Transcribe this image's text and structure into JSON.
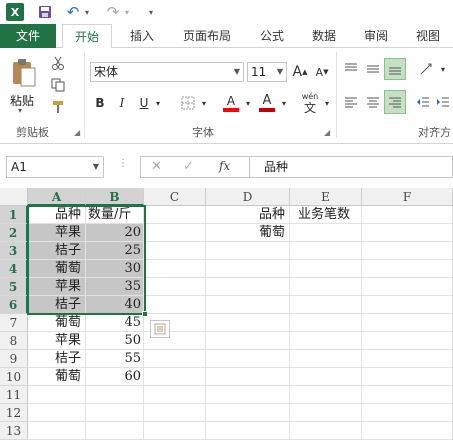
{
  "quick_access": {
    "logo": "X",
    "save_icon": "💾",
    "undo_icon": "↶",
    "undo_arrow": "▾",
    "redo_icon": "↷",
    "redo_arrow": "▾",
    "customize_icon": "▾"
  },
  "tabs": [
    {
      "label": "文件"
    },
    {
      "label": "开始"
    },
    {
      "label": "插入"
    },
    {
      "label": "页面布局"
    },
    {
      "label": "公式"
    },
    {
      "label": "数据"
    },
    {
      "label": "审阅"
    },
    {
      "label": "视图"
    }
  ],
  "ribbon": {
    "clipboard": {
      "label": "剪贴板",
      "paste_label": "粘贴",
      "paste_arrow": "▾"
    },
    "font": {
      "label": "字体",
      "name": "宋体",
      "size": "11",
      "grow": "A",
      "shrink": "A",
      "bold": "B",
      "italic": "I",
      "underline": "U",
      "fill_letter": "A",
      "font_color_letter": "A",
      "phonetic_top": "wén",
      "phonetic_bottom": "文"
    },
    "alignment": {
      "label": "对齐方"
    }
  },
  "formula_bar": {
    "name_box": "A1",
    "fx": "fx",
    "content": "品种"
  },
  "columns": [
    "A",
    "B",
    "C",
    "D",
    "E",
    "F"
  ],
  "rows": [
    "1",
    "2",
    "3",
    "4",
    "5",
    "6",
    "7",
    "8",
    "9",
    "10",
    "11",
    "12",
    "13"
  ],
  "sheet": {
    "A": [
      "品种",
      "苹果",
      "桔子",
      "葡萄",
      "苹果",
      "桔子",
      "葡萄",
      "苹果",
      "桔子",
      "葡萄"
    ],
    "B": [
      "数量/斤",
      "20",
      "25",
      "30",
      "35",
      "40",
      "45",
      "50",
      "55",
      "60"
    ],
    "D": [
      "品种",
      "葡萄"
    ],
    "E": [
      "业务笔数"
    ]
  },
  "colors": {
    "accent": "#217346",
    "selection_fill": "#c6c6c6"
  }
}
